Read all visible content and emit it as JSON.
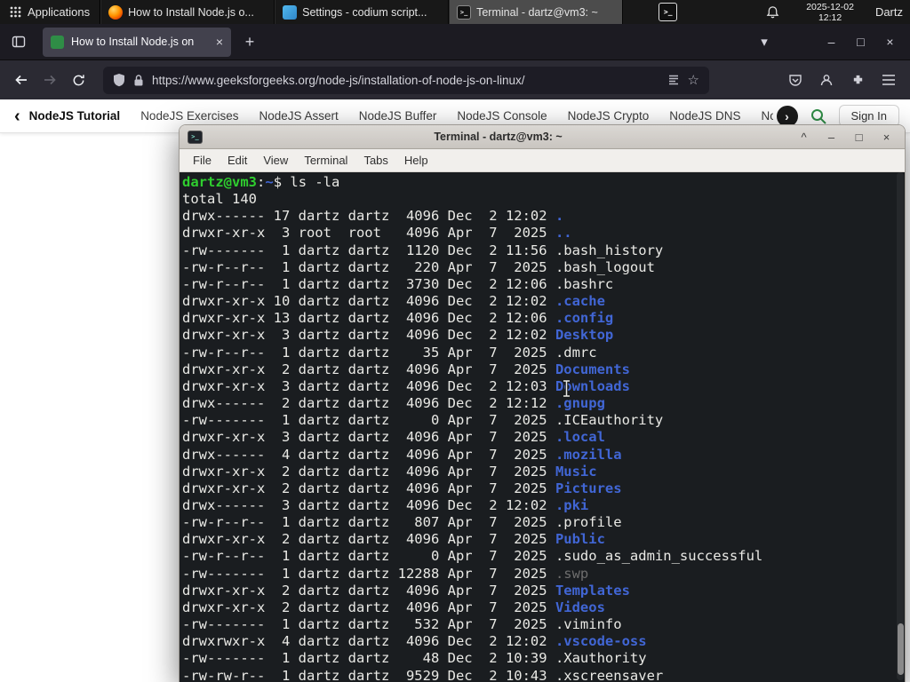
{
  "panel": {
    "applications": "Applications",
    "tasks": [
      {
        "label": "How to Install Node.js o...",
        "icon": "firefox",
        "active": false
      },
      {
        "label": "Settings - codium script...",
        "icon": "codium",
        "active": false
      },
      {
        "label": "Terminal - dartz@vm3: ~",
        "icon": "terminal",
        "active": true
      }
    ],
    "clock_date": "2025-12-02",
    "clock_time": "12:12",
    "user": "Dartz"
  },
  "browser": {
    "tab_title": "How to Install Node.js on",
    "tab_close": "×",
    "new_tab": "+",
    "list_tabs": "▾",
    "win_minimize": "–",
    "win_maximize": "□",
    "win_close": "×",
    "url": "https://www.geeksforgeeks.org/node-js/installation-of-node-js-on-linux/",
    "star": "☆"
  },
  "site_nav": {
    "scroll_left": "‹",
    "scroll_right": "›",
    "items": [
      "NodeJS Tutorial",
      "NodeJS Exercises",
      "NodeJS Assert",
      "NodeJS Buffer",
      "NodeJS Console",
      "NodeJS Crypto",
      "NodeJS DNS",
      "Node"
    ],
    "sign_in": "Sign In"
  },
  "terminal": {
    "title": "Terminal - dartz@vm3: ~",
    "window_buttons": {
      "shade": "^",
      "minimize": "–",
      "maximize": "□",
      "close": "×"
    },
    "menu": [
      "File",
      "Edit",
      "View",
      "Terminal",
      "Tabs",
      "Help"
    ],
    "prompt": {
      "user_host": "dartz@vm3",
      "separator": ":",
      "path": "~",
      "symbol": "$",
      "command": "ls -la"
    },
    "total_line": "total 140",
    "listing": [
      {
        "pre": "drwx------ 17 dartz dartz  4096 Dec  2 12:02 ",
        "name": ".",
        "type": "dir"
      },
      {
        "pre": "drwxr-xr-x  3 root  root   4096 Apr  7  2025 ",
        "name": "..",
        "type": "dir"
      },
      {
        "pre": "-rw-------  1 dartz dartz  1120 Dec  2 11:56 ",
        "name": ".bash_history",
        "type": "file"
      },
      {
        "pre": "-rw-r--r--  1 dartz dartz   220 Apr  7  2025 ",
        "name": ".bash_logout",
        "type": "file"
      },
      {
        "pre": "-rw-r--r--  1 dartz dartz  3730 Dec  2 12:06 ",
        "name": ".bashrc",
        "type": "file"
      },
      {
        "pre": "drwxr-xr-x 10 dartz dartz  4096 Dec  2 12:02 ",
        "name": ".cache",
        "type": "dir"
      },
      {
        "pre": "drwxr-xr-x 13 dartz dartz  4096 Dec  2 12:06 ",
        "name": ".config",
        "type": "dir"
      },
      {
        "pre": "drwxr-xr-x  3 dartz dartz  4096 Dec  2 12:02 ",
        "name": "Desktop",
        "type": "dir"
      },
      {
        "pre": "-rw-r--r--  1 dartz dartz    35 Apr  7  2025 ",
        "name": ".dmrc",
        "type": "file"
      },
      {
        "pre": "drwxr-xr-x  2 dartz dartz  4096 Apr  7  2025 ",
        "name": "Documents",
        "type": "dir"
      },
      {
        "pre": "drwxr-xr-x  3 dartz dartz  4096 Dec  2 12:03 ",
        "name": "Downloads",
        "type": "dir"
      },
      {
        "pre": "drwx------  2 dartz dartz  4096 Dec  2 12:12 ",
        "name": ".gnupg",
        "type": "dir"
      },
      {
        "pre": "-rw-------  1 dartz dartz     0 Apr  7  2025 ",
        "name": ".ICEauthority",
        "type": "file"
      },
      {
        "pre": "drwxr-xr-x  3 dartz dartz  4096 Apr  7  2025 ",
        "name": ".local",
        "type": "dir"
      },
      {
        "pre": "drwx------  4 dartz dartz  4096 Apr  7  2025 ",
        "name": ".mozilla",
        "type": "dir"
      },
      {
        "pre": "drwxr-xr-x  2 dartz dartz  4096 Apr  7  2025 ",
        "name": "Music",
        "type": "dir"
      },
      {
        "pre": "drwxr-xr-x  2 dartz dartz  4096 Apr  7  2025 ",
        "name": "Pictures",
        "type": "dir"
      },
      {
        "pre": "drwx------  3 dartz dartz  4096 Dec  2 12:02 ",
        "name": ".pki",
        "type": "dir"
      },
      {
        "pre": "-rw-r--r--  1 dartz dartz   807 Apr  7  2025 ",
        "name": ".profile",
        "type": "file"
      },
      {
        "pre": "drwxr-xr-x  2 dartz dartz  4096 Apr  7  2025 ",
        "name": "Public",
        "type": "dir"
      },
      {
        "pre": "-rw-r--r--  1 dartz dartz     0 Apr  7  2025 ",
        "name": ".sudo_as_admin_successful",
        "type": "file"
      },
      {
        "pre": "-rw-------  1 dartz dartz 12288 Apr  7  2025 ",
        "name": ".swp",
        "type": "dim"
      },
      {
        "pre": "drwxr-xr-x  2 dartz dartz  4096 Apr  7  2025 ",
        "name": "Templates",
        "type": "dir"
      },
      {
        "pre": "drwxr-xr-x  2 dartz dartz  4096 Apr  7  2025 ",
        "name": "Videos",
        "type": "dir"
      },
      {
        "pre": "-rw-------  1 dartz dartz   532 Apr  7  2025 ",
        "name": ".viminfo",
        "type": "file"
      },
      {
        "pre": "drwxrwxr-x  4 dartz dartz  4096 Dec  2 12:02 ",
        "name": ".vscode-oss",
        "type": "dir"
      },
      {
        "pre": "-rw-------  1 dartz dartz    48 Dec  2 10:39 ",
        "name": ".Xauthority",
        "type": "file"
      },
      {
        "pre": "-rw-rw-r--  1 dartz dartz  9529 Dec  2 10:43 ",
        "name": ".xscreensaver",
        "type": "file"
      }
    ],
    "colors": {
      "background": "#1a1d20",
      "foreground": "#e9e9e5",
      "prompt_green": "#2fce2f",
      "directory_blue": "#4166d5",
      "dim_file": "#6d6d6d"
    }
  },
  "accent_colors": {
    "gfg_green": "#2f8d46",
    "firefox_tab_bg": "#42414d",
    "toolbar_bg": "#2b2a33"
  }
}
